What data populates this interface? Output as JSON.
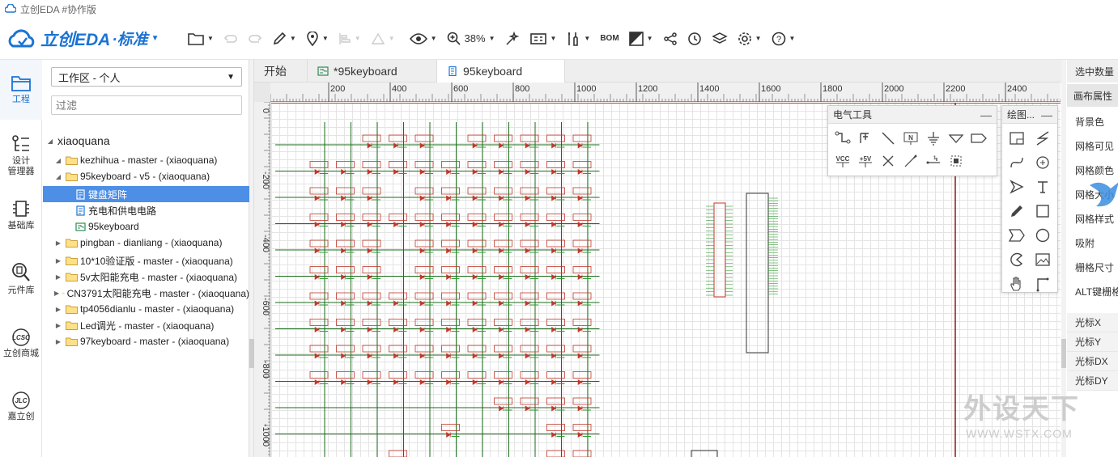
{
  "window": {
    "title": "立创EDA #协作版"
  },
  "toolbar": {
    "brand": "立创EDA",
    "brand_sub": "·标准",
    "zoom": "38%",
    "bom_label": "BOM"
  },
  "leftrail": {
    "items": [
      {
        "label": "工程",
        "icon": "folder-panel-icon"
      },
      {
        "label": "设计\n管理器",
        "icon": "design-manager-icon"
      },
      {
        "label": "基础库",
        "icon": "chip-icon"
      },
      {
        "label": "元件库",
        "icon": "search-parts-icon"
      },
      {
        "label": "立创商城",
        "icon": "lcsc-icon"
      },
      {
        "label": "嘉立创",
        "icon": "jlc-icon"
      }
    ]
  },
  "project_panel": {
    "workspace": "工作区 - 个人",
    "filter_placeholder": "过滤",
    "root": "xiaoquana",
    "tree": [
      {
        "label": "kezhihua - master - (xiaoquana)",
        "type": "folder",
        "level": 1,
        "expanded": false
      },
      {
        "label": "95keyboard - v5 - (xiaoquana)",
        "type": "folder",
        "level": 1,
        "expanded": true
      },
      {
        "label": "键盘矩阵",
        "type": "schematic",
        "level": 2,
        "selected": true
      },
      {
        "label": "充电和供电电路",
        "type": "schematic",
        "level": 2
      },
      {
        "label": "95keyboard",
        "type": "pcb",
        "level": 2
      },
      {
        "label": "pingban - dianliang - (xiaoquana)",
        "type": "folder",
        "level": 1
      },
      {
        "label": "10*10验证版 - master - (xiaoquana)",
        "type": "folder",
        "level": 1
      },
      {
        "label": "5v太阳能充电 - master - (xiaoquana)",
        "type": "folder",
        "level": 1
      },
      {
        "label": "CN3791太阳能充电 - master - (xiaoquana)",
        "type": "folder",
        "level": 1
      },
      {
        "label": "tp4056dianlu - master - (xiaoquana)",
        "type": "folder",
        "level": 1
      },
      {
        "label": "Led调光 - master - (xiaoquana)",
        "type": "folder",
        "level": 1
      },
      {
        "label": "97keyboard - master - (xiaoquana)",
        "type": "folder",
        "level": 1
      }
    ]
  },
  "tabs": [
    {
      "label": "开始",
      "icon": ""
    },
    {
      "label": "*95keyboard",
      "icon": "pcb-tab-icon"
    },
    {
      "label": "95keyboard",
      "icon": "schematic-tab-icon",
      "active": true
    }
  ],
  "ruler": {
    "x_ticks": [
      "200",
      "400",
      "600",
      "800",
      "1000",
      "1200",
      "1400",
      "1600",
      "1800",
      "2000",
      "2200",
      "2400"
    ],
    "y_ticks": [
      "0",
      "-200",
      "-400",
      "-600",
      "-800",
      "-1000"
    ]
  },
  "electrical_tools": {
    "title": "电气工具",
    "minimize": "—"
  },
  "drawing_tools": {
    "title": "绘图...",
    "minimize": "—"
  },
  "right_panel": {
    "header": "选中数量",
    "subheader": "画布属性",
    "rows": [
      "背景色",
      "网格可见",
      "网格颜色",
      "网格大小",
      "网格样式",
      "吸附",
      "栅格尺寸",
      "ALT键栅格"
    ],
    "cursor_rows": [
      "光标X",
      "光标Y",
      "光标DX",
      "光标DY"
    ]
  },
  "watermark": {
    "main": "外设天下",
    "sub": "WWW.WSTX.COM"
  },
  "colors": {
    "accent": "#1a73d4",
    "selection": "#4d8fe6",
    "wire": "#1a6b1a",
    "part": "#c0392b",
    "frame": "#8b1a1a"
  }
}
